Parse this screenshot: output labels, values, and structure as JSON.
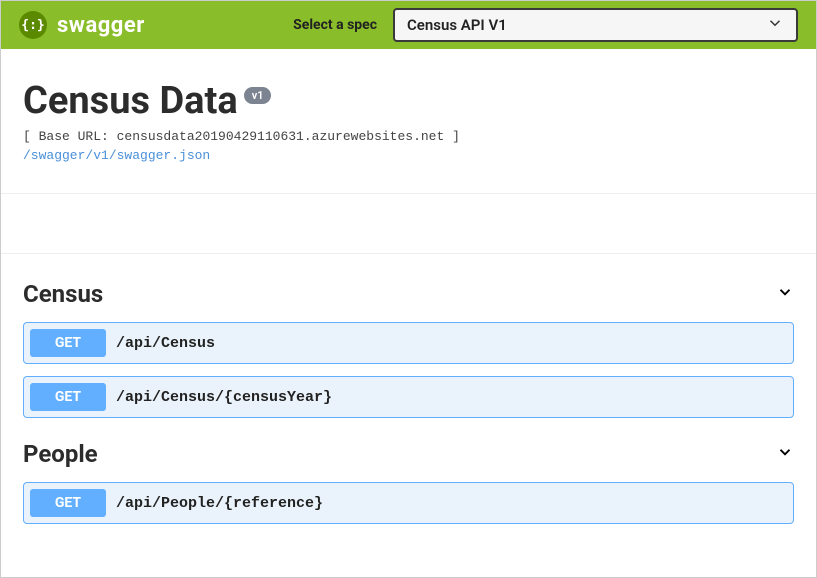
{
  "header": {
    "logo_braces": "{:}",
    "logo_text": "swagger",
    "select_label": "Select a spec",
    "spec_selected": "Census API V1"
  },
  "info": {
    "title": "Census Data",
    "version_badge": "v1",
    "base_url_prefix": "[ Base URL: ",
    "base_url": "censusdata20190429110631.azurewebsites.net",
    "base_url_suffix": " ]",
    "swagger_json_link": "/swagger/v1/swagger.json"
  },
  "tags": [
    {
      "name": "Census",
      "operations": [
        {
          "method": "GET",
          "path": "/api/Census"
        },
        {
          "method": "GET",
          "path": "/api/Census/{censusYear}"
        }
      ]
    },
    {
      "name": "People",
      "operations": [
        {
          "method": "GET",
          "path": "/api/People/{reference}"
        }
      ]
    }
  ]
}
